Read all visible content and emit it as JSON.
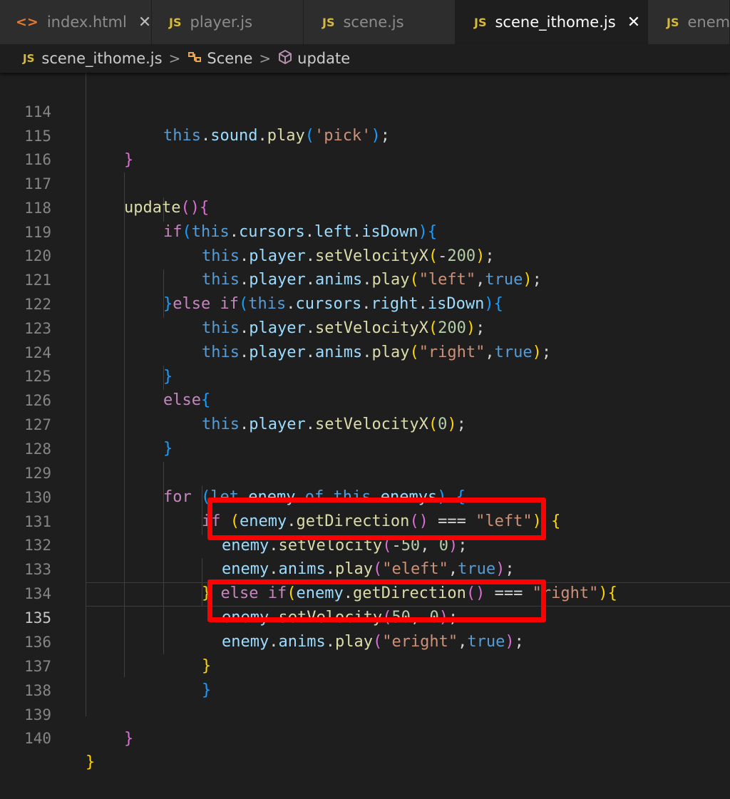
{
  "tabs": [
    {
      "label": "index.html",
      "icon": "html-icon",
      "active": false,
      "close": "✕"
    },
    {
      "label": "player.js",
      "icon": "js-icon",
      "active": false
    },
    {
      "label": "scene.js",
      "icon": "js-icon",
      "active": false
    },
    {
      "label": "scene_ithome.js",
      "icon": "js-icon",
      "active": true,
      "close": "✕"
    },
    {
      "label": "enem",
      "icon": "js-icon",
      "active": false
    }
  ],
  "icons": {
    "js": "JS",
    "html": "<>"
  },
  "breadcrumb": {
    "file": "scene_ithome.js",
    "class": "Scene",
    "method": "update",
    "separator": ">"
  },
  "editor": {
    "line_numbers": [
      "114",
      "115",
      "116",
      "117",
      "118",
      "119",
      "120",
      "121",
      "122",
      "123",
      "124",
      "125",
      "126",
      "127",
      "128",
      "129",
      "130",
      "131",
      "132",
      "133",
      "134",
      "135",
      "136",
      "137",
      "138",
      "139",
      "140"
    ],
    "current_line": "135",
    "lines": [
      "this.sound.play('pick');",
      "}",
      "",
      "update(){",
      "if(this.cursors.left.isDown){",
      "this.player.setVelocityX(-200);",
      "this.player.anims.play(\"left\",true);",
      "}else if(this.cursors.right.isDown){",
      "this.player.setVelocityX(200);",
      "this.player.anims.play(\"right\",true);",
      "}",
      "else{",
      "this.player.setVelocityX(0);",
      "}",
      "",
      "for (let enemy of this.enemys) {",
      "if (enemy.getDirection() === \"left\") {",
      "enemy.setVelocity(-50, 0);",
      "enemy.anims.play(\"eleft\",true);",
      "} else if(enemy.getDirection() === \"right\"){",
      "enemy.setVelocity(50, 0);",
      "enemy.anims.play(\"eright\",true);",
      "}",
      "}",
      "",
      "}",
      "}"
    ]
  },
  "colors": {
    "background": "#1e1e1e",
    "keyword": "#569cd6",
    "control": "#c586c0",
    "property": "#9cdcfe",
    "function": "#dcdcaa",
    "string": "#ce9178",
    "number": "#b5cea8",
    "highlight_box": "#ff0000"
  }
}
